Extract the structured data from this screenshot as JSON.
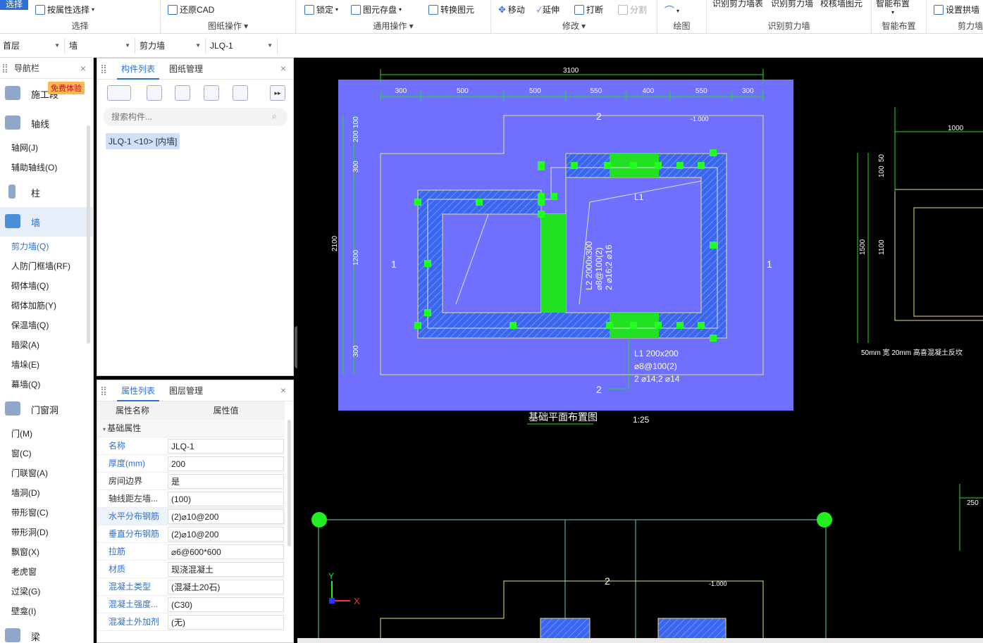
{
  "ribbon": {
    "select_label": "选择",
    "by_attr_select": "按属性选择",
    "group_select": "选择",
    "restore_cad": "还原CAD",
    "group_drawing_ops": "图纸操作",
    "lock": "锁定",
    "element_save": "图元存盘",
    "convert_element": "转换图元",
    "group_common_ops": "通用操作",
    "move": "移动",
    "extend": "延伸",
    "break": "打断",
    "split": "分割",
    "group_modify": "修改",
    "group_draw": "绘图",
    "identify_shear_wall_table": "识别剪力墙表",
    "identify_shear_wall": "识别剪力墙",
    "check_wall_elements": "校核墙图元",
    "group_identify_shear_wall": "识别剪力墙",
    "smart_layout": "智能布置",
    "group_smart_layout": "智能布置",
    "set_arch_wall": "设置拱墙",
    "group_shear_wall_right": "剪力墙"
  },
  "filterbar": {
    "floor": "首层",
    "category": "墙",
    "type": "剪力墙",
    "component": "JLQ-1"
  },
  "nav": {
    "title": "导航栏",
    "free_trial": "免费体验",
    "categories": {
      "construction": "施工段",
      "axis": "轴线",
      "column": "柱",
      "wall": "墙",
      "door_window": "门窗洞",
      "beam": "梁"
    },
    "axis_items": [
      "轴网(J)",
      "辅助轴线(O)"
    ],
    "wall_items": [
      "剪力墙(Q)",
      "人防门框墙(RF)",
      "砌体墙(Q)",
      "砌体加筋(Y)",
      "保温墙(Q)",
      "暗梁(A)",
      "墙垛(E)",
      "幕墙(Q)"
    ],
    "door_items": [
      "门(M)",
      "窗(C)",
      "门联窗(A)",
      "墙洞(D)",
      "带形窗(C)",
      "带形洞(D)",
      "飘窗(X)",
      "老虎窗",
      "过梁(G)",
      "壁龛(I)"
    ]
  },
  "component_panel": {
    "tab_components": "构件列表",
    "tab_drawings": "图纸管理",
    "search_placeholder": "搜索构件...",
    "selected_item": "JLQ-1 <10> [内墙]"
  },
  "property_panel": {
    "tab_properties": "属性列表",
    "tab_layers": "图层管理",
    "col_name": "属性名称",
    "col_value": "属性值",
    "group_basic": "基础属性",
    "rows": [
      {
        "name": "名称",
        "value": "JLQ-1"
      },
      {
        "name": "厚度(mm)",
        "value": "200"
      },
      {
        "name": "房间边界",
        "value": "是"
      },
      {
        "name": "轴线距左墙...",
        "value": "(100)"
      },
      {
        "name": "水平分布钢筋",
        "value": "(2)⌀10@200"
      },
      {
        "name": "垂直分布钢筋",
        "value": "(2)⌀10@200"
      },
      {
        "name": "拉筋",
        "value": "⌀6@600*600"
      },
      {
        "name": "材质",
        "value": "现浇混凝土"
      },
      {
        "name": "混凝土类型",
        "value": "(混凝土20石)"
      },
      {
        "name": "混凝土强度...",
        "value": "(C30)"
      },
      {
        "name": "混凝土外加剂",
        "value": "(无)"
      }
    ]
  },
  "cad": {
    "dim_total": "3100",
    "dims_top": [
      "300",
      "500",
      "500",
      "550",
      "400",
      "550",
      "300"
    ],
    "dims_left": [
      "100",
      "200",
      "300",
      "1200",
      "300"
    ],
    "dim_left_total": "2100",
    "level": "-1.000",
    "label_L1": "L1",
    "beam_L2": [
      "L2 2000x300",
      "⌀8@100(2)",
      "2 ⌀16;2 ⌀16"
    ],
    "beam_L1": [
      "L1  200x200",
      "⌀8@100(2)",
      "2 ⌀14;2 ⌀14"
    ],
    "section_1": "1",
    "section_2": "2",
    "drawing_title": "基础平面布置图",
    "scale": "1:25",
    "right_dims": [
      "1000",
      "1500",
      "1100",
      "50",
      "100",
      "250"
    ],
    "right_note": "50mm 宽 20mm 高喜混凝土反坎",
    "axis_x": "X",
    "axis_y": "Y"
  }
}
